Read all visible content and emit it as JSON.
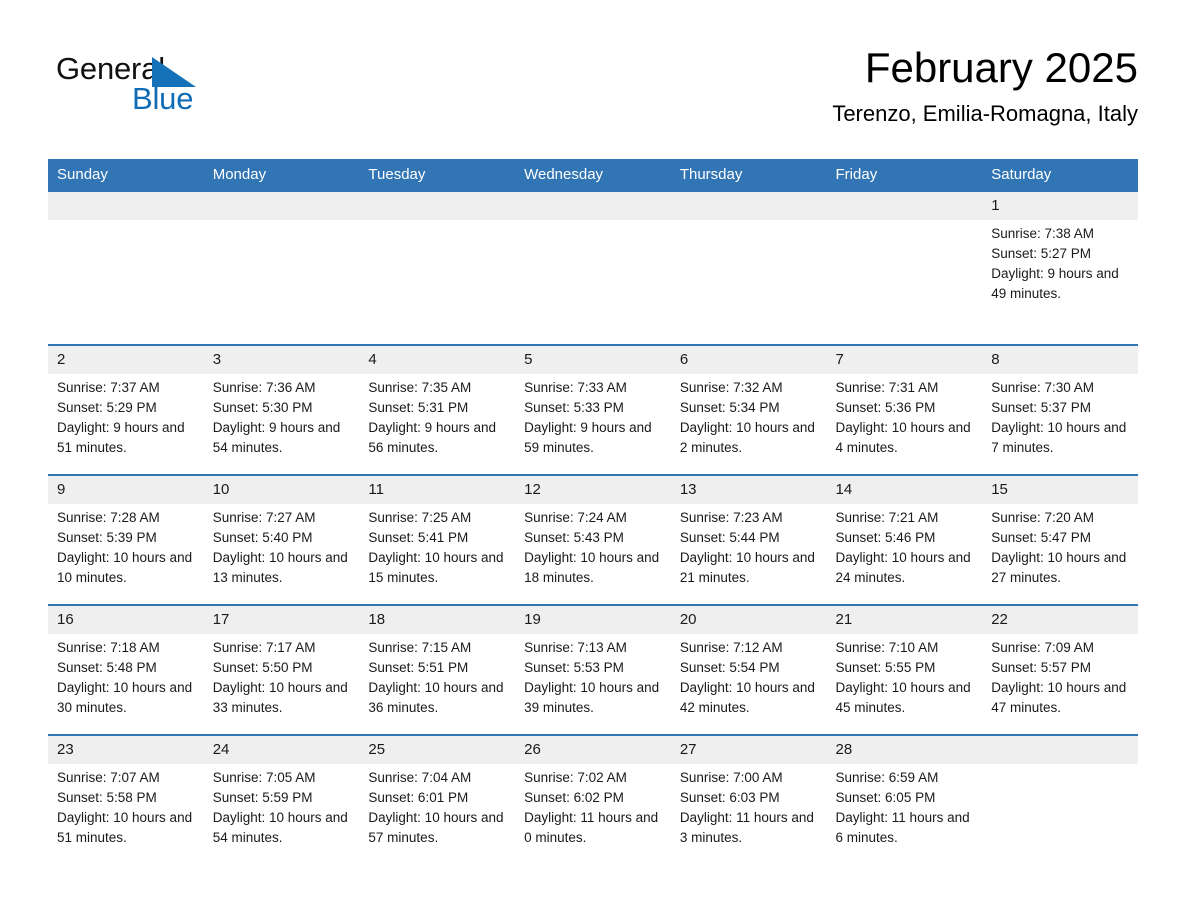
{
  "brand": {
    "name_part1": "General",
    "name_part2": "Blue",
    "accent_color": "#1571b8"
  },
  "header": {
    "month_title": "February 2025",
    "location": "Terenzo, Emilia-Romagna, Italy"
  },
  "theme": {
    "header_row_bg": "#3275b5",
    "daynum_bg": "#efefef",
    "cell_bg": "#ffffff",
    "text_color": "#1a1a1a"
  },
  "weekday_headers": [
    "Sunday",
    "Monday",
    "Tuesday",
    "Wednesday",
    "Thursday",
    "Friday",
    "Saturday"
  ],
  "weeks": [
    [
      {
        "day": "",
        "empty": true
      },
      {
        "day": "",
        "empty": true
      },
      {
        "day": "",
        "empty": true
      },
      {
        "day": "",
        "empty": true
      },
      {
        "day": "",
        "empty": true
      },
      {
        "day": "",
        "empty": true
      },
      {
        "day": "1",
        "sunrise": "Sunrise: 7:38 AM",
        "sunset": "Sunset: 5:27 PM",
        "daylight": "Daylight: 9 hours and 49 minutes."
      }
    ],
    [
      {
        "day": "2",
        "sunrise": "Sunrise: 7:37 AM",
        "sunset": "Sunset: 5:29 PM",
        "daylight": "Daylight: 9 hours and 51 minutes."
      },
      {
        "day": "3",
        "sunrise": "Sunrise: 7:36 AM",
        "sunset": "Sunset: 5:30 PM",
        "daylight": "Daylight: 9 hours and 54 minutes."
      },
      {
        "day": "4",
        "sunrise": "Sunrise: 7:35 AM",
        "sunset": "Sunset: 5:31 PM",
        "daylight": "Daylight: 9 hours and 56 minutes."
      },
      {
        "day": "5",
        "sunrise": "Sunrise: 7:33 AM",
        "sunset": "Sunset: 5:33 PM",
        "daylight": "Daylight: 9 hours and 59 minutes."
      },
      {
        "day": "6",
        "sunrise": "Sunrise: 7:32 AM",
        "sunset": "Sunset: 5:34 PM",
        "daylight": "Daylight: 10 hours and 2 minutes."
      },
      {
        "day": "7",
        "sunrise": "Sunrise: 7:31 AM",
        "sunset": "Sunset: 5:36 PM",
        "daylight": "Daylight: 10 hours and 4 minutes."
      },
      {
        "day": "8",
        "sunrise": "Sunrise: 7:30 AM",
        "sunset": "Sunset: 5:37 PM",
        "daylight": "Daylight: 10 hours and 7 minutes."
      }
    ],
    [
      {
        "day": "9",
        "sunrise": "Sunrise: 7:28 AM",
        "sunset": "Sunset: 5:39 PM",
        "daylight": "Daylight: 10 hours and 10 minutes."
      },
      {
        "day": "10",
        "sunrise": "Sunrise: 7:27 AM",
        "sunset": "Sunset: 5:40 PM",
        "daylight": "Daylight: 10 hours and 13 minutes."
      },
      {
        "day": "11",
        "sunrise": "Sunrise: 7:25 AM",
        "sunset": "Sunset: 5:41 PM",
        "daylight": "Daylight: 10 hours and 15 minutes."
      },
      {
        "day": "12",
        "sunrise": "Sunrise: 7:24 AM",
        "sunset": "Sunset: 5:43 PM",
        "daylight": "Daylight: 10 hours and 18 minutes."
      },
      {
        "day": "13",
        "sunrise": "Sunrise: 7:23 AM",
        "sunset": "Sunset: 5:44 PM",
        "daylight": "Daylight: 10 hours and 21 minutes."
      },
      {
        "day": "14",
        "sunrise": "Sunrise: 7:21 AM",
        "sunset": "Sunset: 5:46 PM",
        "daylight": "Daylight: 10 hours and 24 minutes."
      },
      {
        "day": "15",
        "sunrise": "Sunrise: 7:20 AM",
        "sunset": "Sunset: 5:47 PM",
        "daylight": "Daylight: 10 hours and 27 minutes."
      }
    ],
    [
      {
        "day": "16",
        "sunrise": "Sunrise: 7:18 AM",
        "sunset": "Sunset: 5:48 PM",
        "daylight": "Daylight: 10 hours and 30 minutes."
      },
      {
        "day": "17",
        "sunrise": "Sunrise: 7:17 AM",
        "sunset": "Sunset: 5:50 PM",
        "daylight": "Daylight: 10 hours and 33 minutes."
      },
      {
        "day": "18",
        "sunrise": "Sunrise: 7:15 AM",
        "sunset": "Sunset: 5:51 PM",
        "daylight": "Daylight: 10 hours and 36 minutes."
      },
      {
        "day": "19",
        "sunrise": "Sunrise: 7:13 AM",
        "sunset": "Sunset: 5:53 PM",
        "daylight": "Daylight: 10 hours and 39 minutes."
      },
      {
        "day": "20",
        "sunrise": "Sunrise: 7:12 AM",
        "sunset": "Sunset: 5:54 PM",
        "daylight": "Daylight: 10 hours and 42 minutes."
      },
      {
        "day": "21",
        "sunrise": "Sunrise: 7:10 AM",
        "sunset": "Sunset: 5:55 PM",
        "daylight": "Daylight: 10 hours and 45 minutes."
      },
      {
        "day": "22",
        "sunrise": "Sunrise: 7:09 AM",
        "sunset": "Sunset: 5:57 PM",
        "daylight": "Daylight: 10 hours and 47 minutes."
      }
    ],
    [
      {
        "day": "23",
        "sunrise": "Sunrise: 7:07 AM",
        "sunset": "Sunset: 5:58 PM",
        "daylight": "Daylight: 10 hours and 51 minutes."
      },
      {
        "day": "24",
        "sunrise": "Sunrise: 7:05 AM",
        "sunset": "Sunset: 5:59 PM",
        "daylight": "Daylight: 10 hours and 54 minutes."
      },
      {
        "day": "25",
        "sunrise": "Sunrise: 7:04 AM",
        "sunset": "Sunset: 6:01 PM",
        "daylight": "Daylight: 10 hours and 57 minutes."
      },
      {
        "day": "26",
        "sunrise": "Sunrise: 7:02 AM",
        "sunset": "Sunset: 6:02 PM",
        "daylight": "Daylight: 11 hours and 0 minutes."
      },
      {
        "day": "27",
        "sunrise": "Sunrise: 7:00 AM",
        "sunset": "Sunset: 6:03 PM",
        "daylight": "Daylight: 11 hours and 3 minutes."
      },
      {
        "day": "28",
        "sunrise": "Sunrise: 6:59 AM",
        "sunset": "Sunset: 6:05 PM",
        "daylight": "Daylight: 11 hours and 6 minutes."
      },
      {
        "day": "",
        "empty": true
      }
    ]
  ]
}
